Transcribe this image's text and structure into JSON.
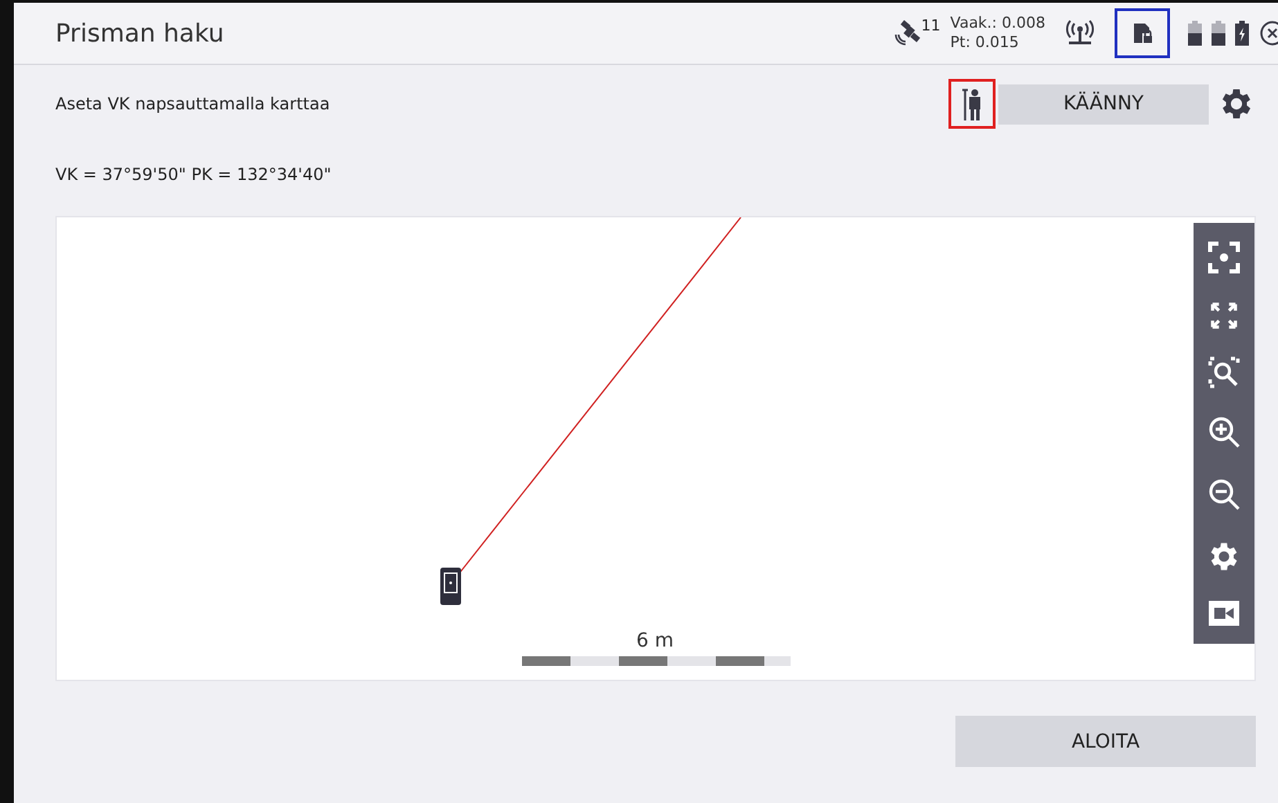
{
  "header": {
    "title": "Prisman haku",
    "satellites": "11",
    "precision": [
      "Vaak.: 0.008",
      "Pt: 0.015"
    ]
  },
  "instruction": "Aseta VK napsauttamalla karttaa",
  "angles": "VK = 37°59'50\"  PK = 132°34'40\"",
  "turn_button": "KÄÄNNY",
  "map": {
    "scale_label": "6 m"
  },
  "start_button": "ALOITA"
}
